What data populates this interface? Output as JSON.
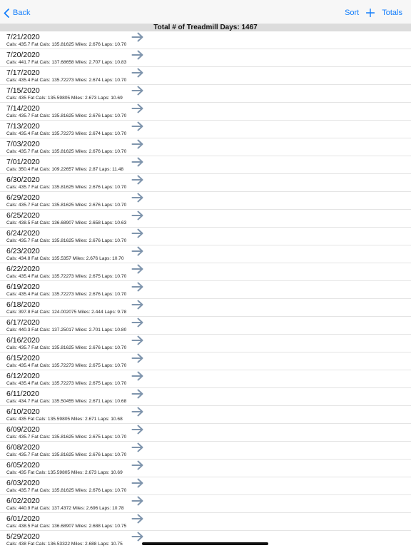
{
  "navbar": {
    "back_label": "Back",
    "sort_label": "Sort",
    "add_icon": "plus-icon",
    "totals_label": "Totals",
    "accent_color": "#147efb"
  },
  "summary": {
    "text": "Total # of Treadmill Days: 1467"
  },
  "rows": [
    {
      "date": "7/21/2020",
      "detail": "Cals: 435.7 Fat Cals: 135.81625 Miles: 2.676 Laps: 10.70"
    },
    {
      "date": "7/20/2020",
      "detail": "Cals: 441.7 Fat Cals: 137.68658 Miles: 2.707 Laps: 10.83"
    },
    {
      "date": "7/17/2020",
      "detail": "Cals: 435.4 Fat Cals: 135.72273 Miles: 2.674 Laps: 10.70"
    },
    {
      "date": "7/15/2020",
      "detail": "Cals: 435 Fat Cals: 135.59805 Miles: 2.673 Laps: 10.69"
    },
    {
      "date": "7/14/2020",
      "detail": "Cals: 435.7 Fat Cals: 135.81625 Miles: 2.676 Laps: 10.70"
    },
    {
      "date": "7/13/2020",
      "detail": "Cals: 435.4 Fat Cals: 135.72273 Miles: 2.674 Laps: 10.70"
    },
    {
      "date": "7/03/2020",
      "detail": "Cals: 435.7 Fat Cals: 135.81625 Miles: 2.676 Laps: 10.70"
    },
    {
      "date": "7/01/2020",
      "detail": "Cals: 350.4 Fat Cals: 109.22657 Miles: 2.87 Laps: 11.48"
    },
    {
      "date": "6/30/2020",
      "detail": "Cals: 435.7 Fat Cals: 135.81625 Miles: 2.676 Laps: 10.70"
    },
    {
      "date": "6/29/2020",
      "detail": "Cals: 435.7 Fat Cals: 135.81625 Miles: 2.676 Laps: 10.70"
    },
    {
      "date": "6/25/2020",
      "detail": "Cals: 438.5 Fat Cals: 136.68907 Miles: 2.658 Laps: 10.63"
    },
    {
      "date": "6/24/2020",
      "detail": "Cals: 435.7 Fat Cals: 135.81625 Miles: 2.676 Laps: 10.70"
    },
    {
      "date": "6/23/2020",
      "detail": "Cals: 434.8 Fat Cals: 135.5357 Miles: 2.676 Laps: 10.70"
    },
    {
      "date": "6/22/2020",
      "detail": "Cals: 435.4 Fat Cals: 135.72273 Miles: 2.675 Laps: 10.70"
    },
    {
      "date": "6/19/2020",
      "detail": "Cals: 435.4 Fat Cals: 135.72273 Miles: 2.676 Laps: 10.70"
    },
    {
      "date": "6/18/2020",
      "detail": "Cals: 397.8 Fat Cals: 124.002075 Miles: 2.444 Laps: 9.78"
    },
    {
      "date": "6/17/2020",
      "detail": "Cals: 440.3 Fat Cals: 137.25017 Miles: 2.701 Laps: 10.80"
    },
    {
      "date": "6/16/2020",
      "detail": "Cals: 435.7 Fat Cals: 135.81625 Miles: 2.676 Laps: 10.70"
    },
    {
      "date": "6/15/2020",
      "detail": "Cals: 435.4 Fat Cals: 135.72273 Miles: 2.675 Laps: 10.70"
    },
    {
      "date": "6/12/2020",
      "detail": "Cals: 435.4 Fat Cals: 135.72273 Miles: 2.675 Laps: 10.70"
    },
    {
      "date": "6/11/2020",
      "detail": "Cals: 434.7 Fat Cals: 135.50455 Miles: 2.671 Laps: 10.68"
    },
    {
      "date": "6/10/2020",
      "detail": "Cals: 435 Fat Cals: 135.59805 Miles: 2.671 Laps: 10.68"
    },
    {
      "date": "6/09/2020",
      "detail": "Cals: 435.7 Fat Cals: 135.81625 Miles: 2.675 Laps: 10.70"
    },
    {
      "date": "6/08/2020",
      "detail": "Cals: 435.7 Fat Cals: 135.81625 Miles: 2.676 Laps: 10.70"
    },
    {
      "date": "6/05/2020",
      "detail": "Cals: 435 Fat Cals: 135.59805 Miles: 2.673 Laps: 10.69"
    },
    {
      "date": "6/03/2020",
      "detail": "Cals: 435.7 Fat Cals: 135.81625 Miles: 2.676 Laps: 10.70"
    },
    {
      "date": "6/02/2020",
      "detail": "Cals: 440.9 Fat Cals: 137.4372 Miles: 2.696 Laps: 10.78"
    },
    {
      "date": "6/01/2020",
      "detail": "Cals: 438.5 Fat Cals: 136.68907 Miles: 2.688 Laps: 10.75"
    },
    {
      "date": "5/29/2020",
      "detail": "Cals: 438 Fat Cals: 136.53322 Miles: 2.688 Laps: 10.75"
    }
  ],
  "row_icon": "arrow-right-icon",
  "arrow_color": "#7f95ad"
}
